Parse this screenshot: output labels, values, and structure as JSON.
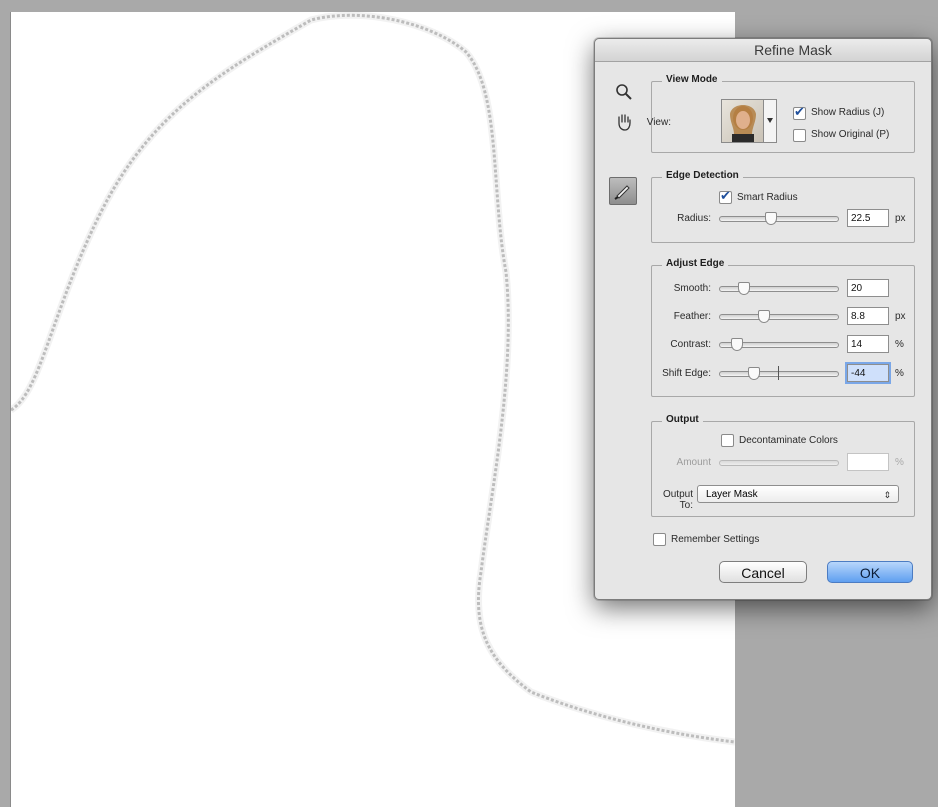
{
  "dialog": {
    "title": "Refine Mask"
  },
  "view_mode": {
    "title": "View Mode",
    "view_label": "View:",
    "show_radius": {
      "label": "Show Radius (J)",
      "checked": true
    },
    "show_original": {
      "label": "Show Original (P)",
      "checked": false
    }
  },
  "edge_detection": {
    "title": "Edge Detection",
    "smart_radius": {
      "label": "Smart Radius",
      "checked": true
    },
    "radius": {
      "label": "Radius:",
      "value": "22.5",
      "unit": "px",
      "level": 0.4
    }
  },
  "adjust_edge": {
    "title": "Adjust Edge",
    "smooth": {
      "label": "Smooth:",
      "value": "20",
      "unit": "",
      "level": 0.2
    },
    "feather": {
      "label": "Feather:",
      "value": "8.8",
      "unit": "px",
      "level": 0.35
    },
    "contrast": {
      "label": "Contrast:",
      "value": "14",
      "unit": "%",
      "level": 0.14
    },
    "shift_edge": {
      "label": "Shift Edge:",
      "value": "-44",
      "unit": "%",
      "level": 0.28
    }
  },
  "output": {
    "title": "Output",
    "decontaminate": {
      "label": "Decontaminate Colors",
      "checked": false
    },
    "amount": {
      "label": "Amount",
      "value": "",
      "unit": "%"
    },
    "output_to": {
      "label": "Output To:",
      "value": "Layer Mask"
    }
  },
  "remember": {
    "label": "Remember Settings",
    "checked": false
  },
  "buttons": {
    "cancel": "Cancel",
    "ok": "OK"
  },
  "icons": {
    "zoom": "zoom-tool-icon",
    "hand": "hand-tool-icon",
    "brush": "refine-radius-brush-icon"
  }
}
